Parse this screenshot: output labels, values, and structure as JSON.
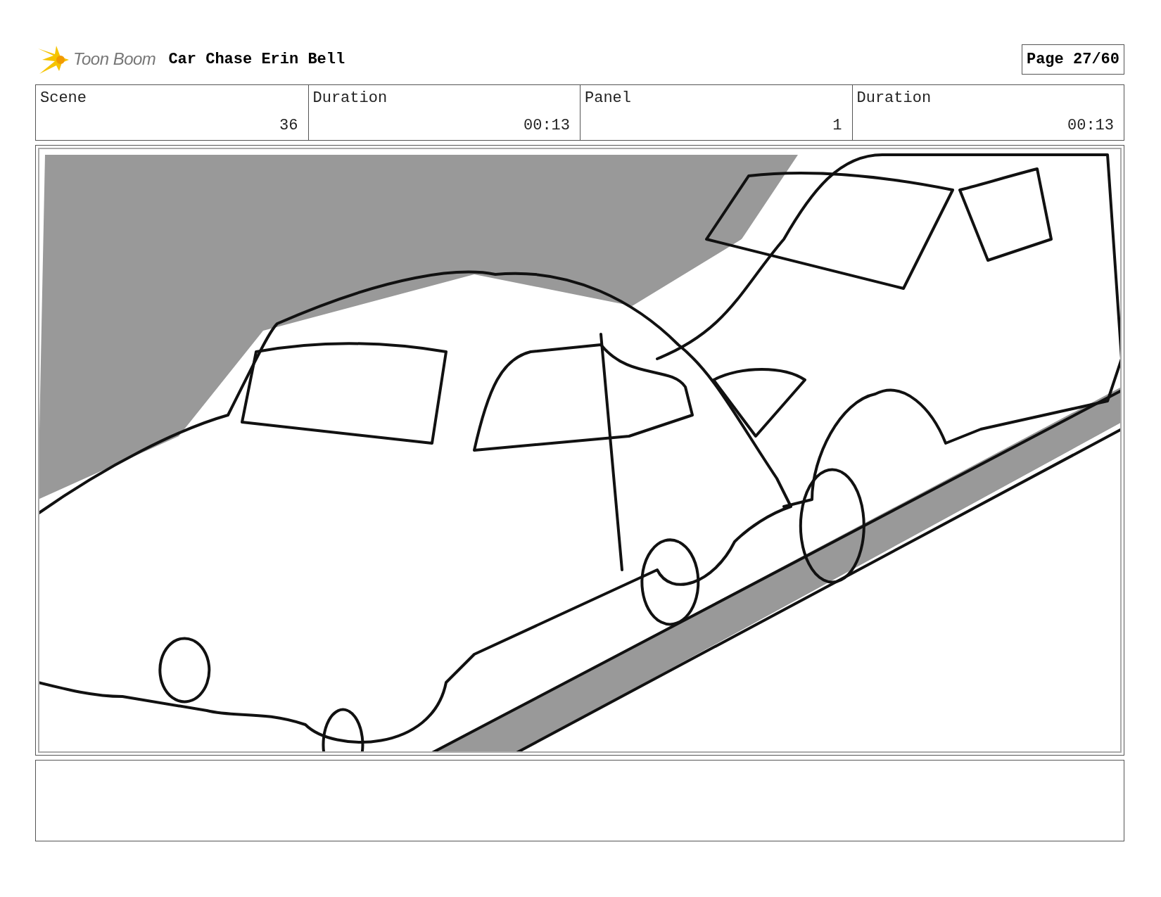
{
  "header": {
    "logo_text": "Toon Boom",
    "title": "Car Chase Erin Bell",
    "page": "Page 27/60"
  },
  "info": [
    {
      "label": "Scene",
      "value": "36"
    },
    {
      "label": "Duration",
      "value": "00:13"
    },
    {
      "label": "Panel",
      "value": "1"
    },
    {
      "label": "Duration",
      "value": "00:13"
    }
  ]
}
